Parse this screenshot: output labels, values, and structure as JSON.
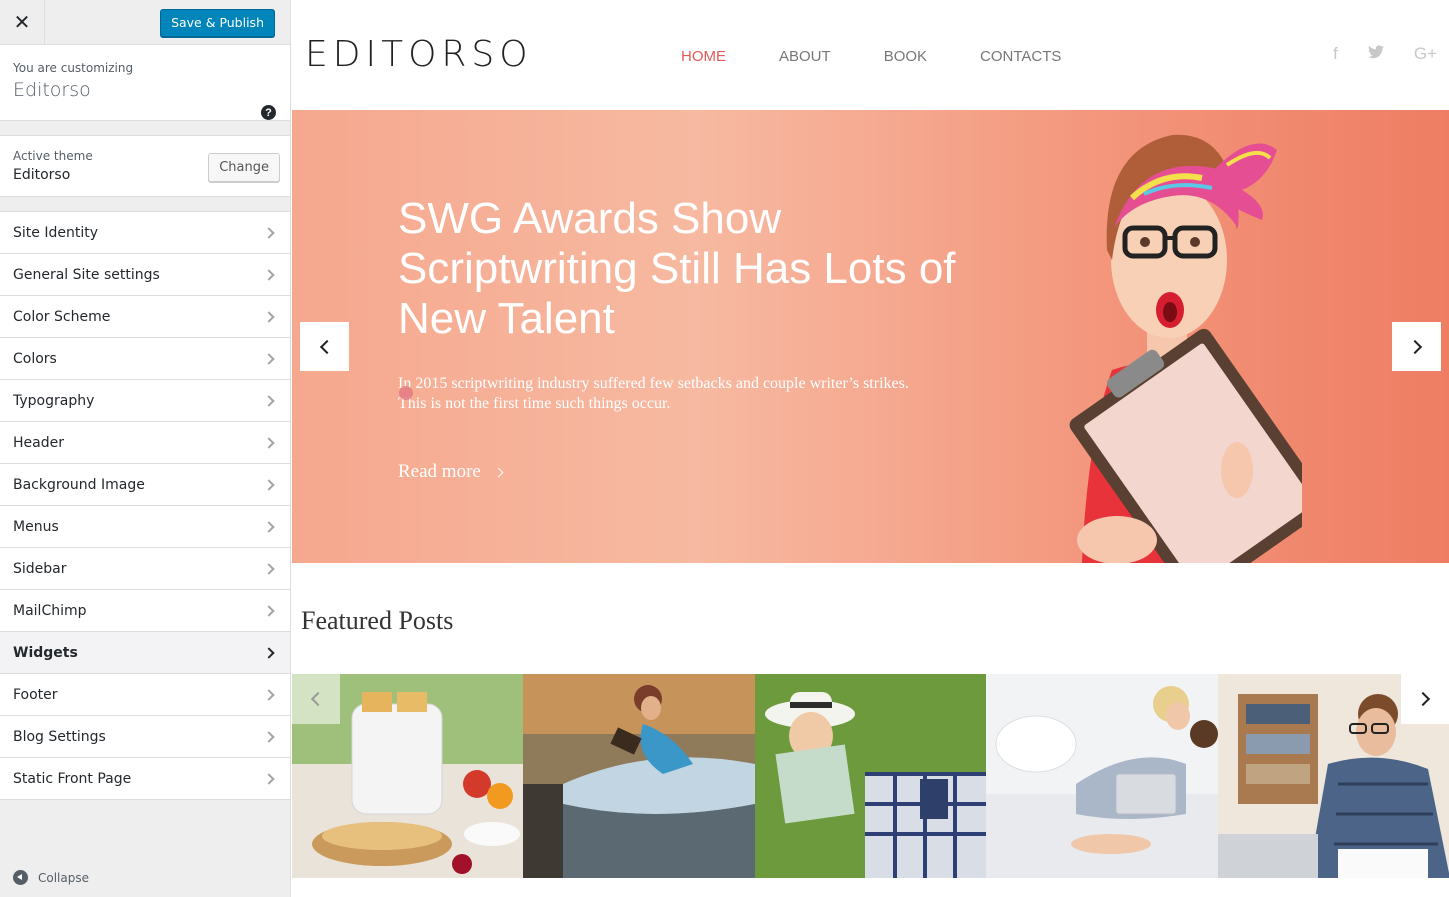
{
  "customizer": {
    "close_icon": "close-icon",
    "save_label": "Save & Publish",
    "customizing_label": "You are customizing",
    "site_name": "Editorso",
    "help_icon": "help-icon",
    "active_theme_label": "Active theme",
    "active_theme": "Editorso",
    "change_label": "Change",
    "sections": [
      {
        "label": "Site Identity"
      },
      {
        "label": "General Site settings"
      },
      {
        "label": "Color Scheme"
      },
      {
        "label": "Colors"
      },
      {
        "label": "Typography"
      },
      {
        "label": "Header"
      },
      {
        "label": "Background Image"
      },
      {
        "label": "Menus"
      },
      {
        "label": "Sidebar"
      },
      {
        "label": "MailChimp"
      },
      {
        "label": "Widgets"
      },
      {
        "label": "Footer"
      },
      {
        "label": "Blog Settings"
      },
      {
        "label": "Static Front Page"
      }
    ],
    "active_section": "Widgets",
    "collapse_label": "Collapse",
    "accent_color": "#0085ba"
  },
  "site": {
    "logo": "EDITORSO",
    "nav": [
      "HOME",
      "ABOUT",
      "BOOK",
      "CONTACTS"
    ],
    "current_nav": "HOME",
    "social_icons": [
      "facebook-icon",
      "twitter-icon",
      "google-plus-icon"
    ],
    "social_glyphs": [
      "f",
      "🐦",
      "G+"
    ],
    "accent_color": "#e25b58"
  },
  "hero": {
    "title": "SWG Awards Show Scriptwriting Still Has Lots of New Talent",
    "text": "In 2015 scriptwriting industry suffered few setbacks and couple writer’s strikes. This is not the first time such things occur.",
    "read_more": "Read more"
  },
  "featured": {
    "heading": "Featured Posts",
    "posts": [
      "breakfast-toaster-photo",
      "woman-reading-lake-photo",
      "girl-with-book-photo",
      "mother-child-laptop-photo",
      "man-writing-photo"
    ]
  }
}
